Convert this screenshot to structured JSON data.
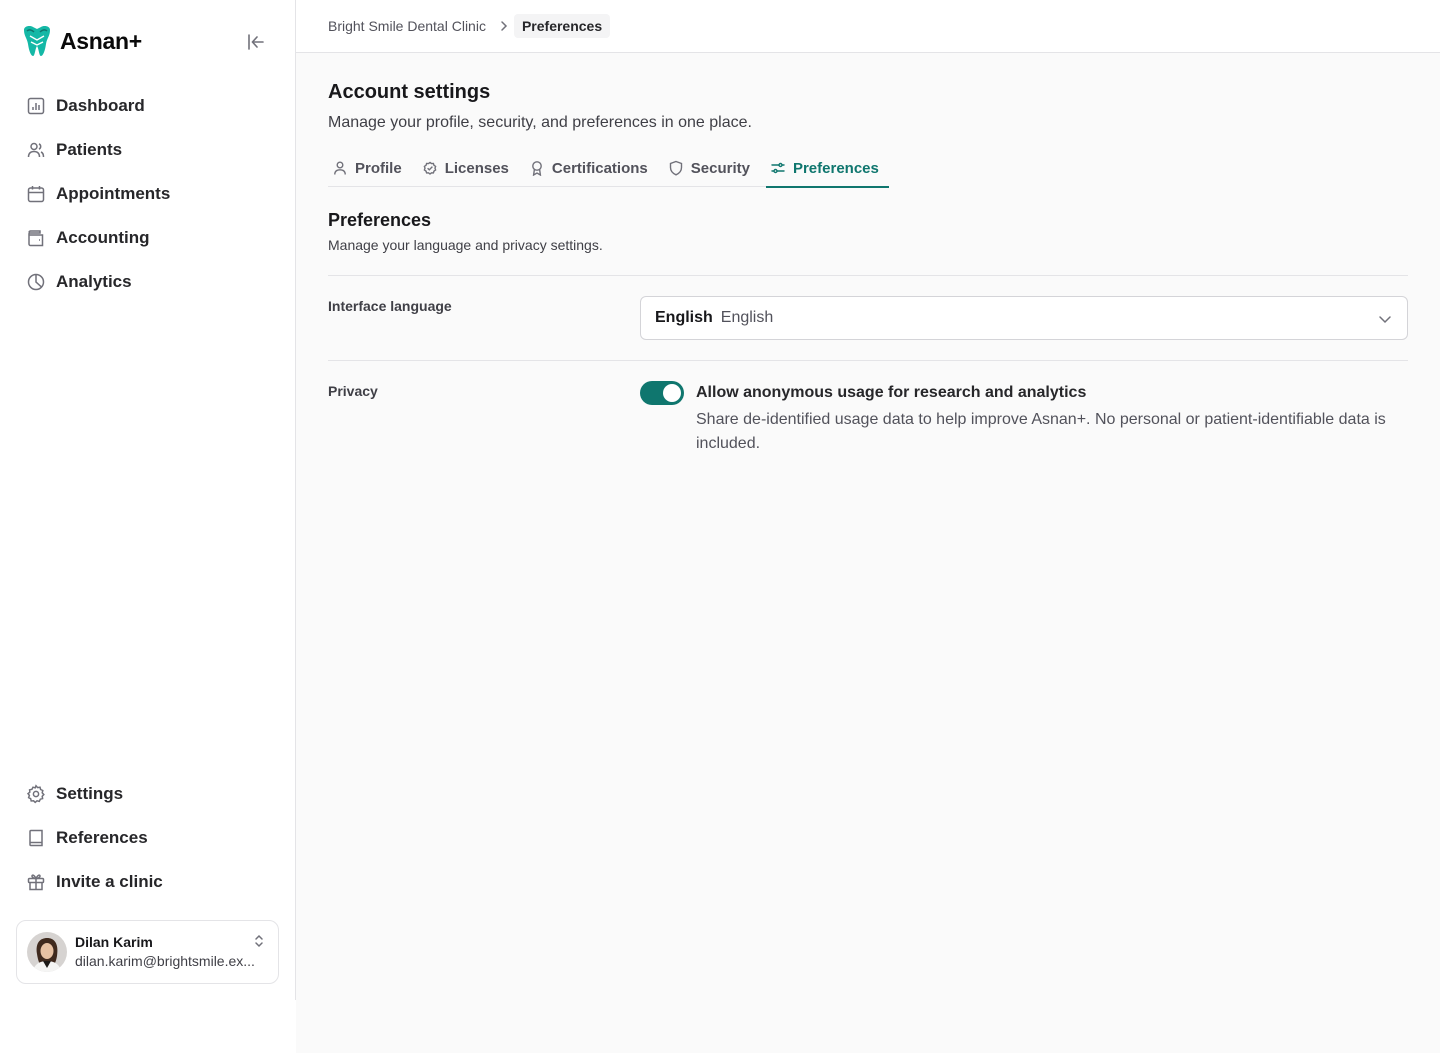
{
  "brand": {
    "name": "Asnan+",
    "accent": "#0f766e",
    "logo_icon": "tooth-logo-icon"
  },
  "sidebar": {
    "collapse_icon": "collapse-sidebar-icon",
    "top_items": [
      {
        "label": "Dashboard",
        "icon": "dashboard-icon"
      },
      {
        "label": "Patients",
        "icon": "users-icon"
      },
      {
        "label": "Appointments",
        "icon": "calendar-icon"
      },
      {
        "label": "Accounting",
        "icon": "wallet-icon"
      },
      {
        "label": "Analytics",
        "icon": "pie-chart-icon"
      }
    ],
    "bottom_items": [
      {
        "label": "Settings",
        "icon": "gear-icon"
      },
      {
        "label": "References",
        "icon": "book-icon"
      },
      {
        "label": "Invite a clinic",
        "icon": "gift-icon"
      }
    ],
    "user": {
      "name": "Dilan Karim",
      "email": "dilan.karim@brightsmile.ex..."
    }
  },
  "breadcrumb": {
    "root": "Bright Smile Dental Clinic",
    "current": "Preferences"
  },
  "page": {
    "title": "Account settings",
    "subtitle": "Manage your profile, security, and preferences in one place."
  },
  "tabs": [
    {
      "label": "Profile",
      "icon": "user-icon"
    },
    {
      "label": "Licenses",
      "icon": "check-circle-icon"
    },
    {
      "label": "Certifications",
      "icon": "award-icon"
    },
    {
      "label": "Security",
      "icon": "shield-icon"
    },
    {
      "label": "Preferences",
      "icon": "sliders-icon",
      "active": true
    }
  ],
  "preferences": {
    "title": "Preferences",
    "subtitle": "Manage your language and privacy settings.",
    "language": {
      "label": "Interface language",
      "value_native": "English",
      "value_english": "English"
    },
    "privacy": {
      "label": "Privacy",
      "toggle_on": true,
      "toggle_label": "Allow anonymous usage for research and analytics",
      "toggle_description": "Share de-identified usage data to help improve Asnan+. No personal or patient-identifiable data is included."
    }
  }
}
